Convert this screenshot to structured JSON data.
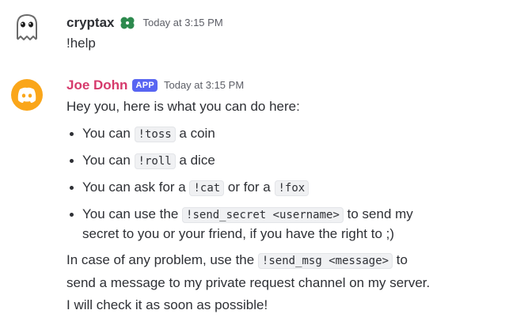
{
  "messages": [
    {
      "username": "cryptax",
      "username_color": "#2e3035",
      "timestamp": "Today at 3:15 PM",
      "text": "!help",
      "avatar_icon": "ghost-icon",
      "role_icon": "clover-icon"
    },
    {
      "username": "Joe Dohn",
      "username_color": "#d63a6c",
      "badge": "APP",
      "timestamp": "Today at 3:15 PM",
      "avatar_icon": "discord-logo-icon",
      "avatar_color": "#faa61a",
      "intro": "Hey you, here is what you can do here:",
      "bullets": [
        {
          "before": "You can ",
          "code": "!toss",
          "after": " a coin"
        },
        {
          "before": "You can ",
          "code": "!roll",
          "after": " a dice"
        },
        {
          "before": "You can ask for a ",
          "code": "!cat",
          "middle": " or for a ",
          "code2": "!fox"
        },
        {
          "before": "You can use the ",
          "code": "!send_secret <username>",
          "after": " to send my",
          "line2": "secret to you or your friend, if you have the right to ;)"
        }
      ],
      "outro": {
        "before": "In case of any problem, use the ",
        "code": "!send_msg <message>",
        "after": " to",
        "line2": "send a message to my private request channel on my server.",
        "line3": "I will check it as soon as possible!"
      }
    }
  ]
}
